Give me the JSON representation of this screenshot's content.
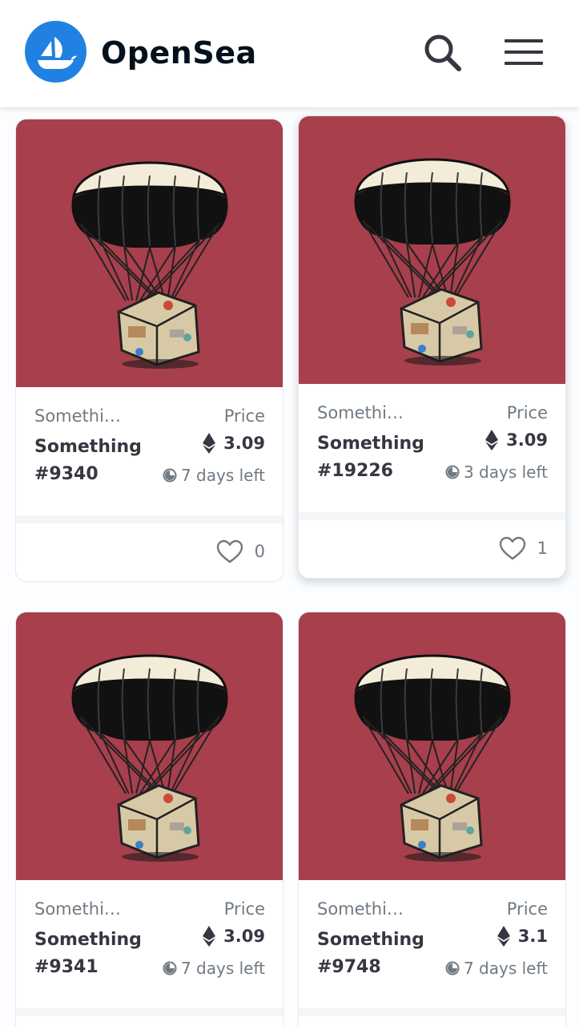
{
  "header": {
    "brand": "OpenSea",
    "brand_color": "#2081e2",
    "icons": {
      "logo": "opensea-ship-logo",
      "search": "search-icon",
      "menu": "hamburger-menu-icon"
    }
  },
  "theme": {
    "image_bg": "#a83f4c",
    "text_muted": "#707a83",
    "text_main": "#353840"
  },
  "cards": [
    {
      "collection": "Somethi…",
      "name": "Something #9340",
      "price_label": "Price",
      "price": "3.09",
      "time_left": "7 days left",
      "likes": "0"
    },
    {
      "collection": "Somethi…",
      "name": "Something #19226",
      "price_label": "Price",
      "price": "3.09",
      "time_left": "3 days left",
      "likes": "1"
    },
    {
      "collection": "Somethi…",
      "name": "Something #9341",
      "price_label": "Price",
      "price": "3.09",
      "time_left": "7 days left",
      "likes": ""
    },
    {
      "collection": "Somethi…",
      "name": "Something #9748",
      "price_label": "Price",
      "price": "3.1",
      "time_left": "7 days left",
      "likes": ""
    }
  ]
}
